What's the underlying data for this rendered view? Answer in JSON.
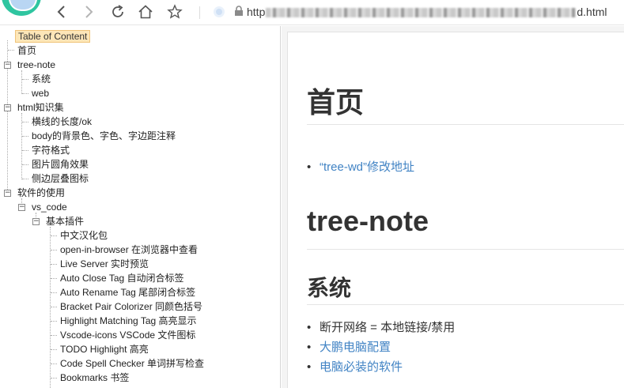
{
  "browser": {
    "url_prefix": "http",
    "url_suffix": "d.html",
    "icons": [
      "back-icon",
      "forward-icon",
      "refresh-icon",
      "home-icon",
      "star-icon",
      "lock-icon"
    ]
  },
  "toc": {
    "title": "Table of Content",
    "items": [
      {
        "label": "首页"
      },
      {
        "label": "tree-note"
      },
      {
        "label": "系统"
      },
      {
        "label": "web"
      },
      {
        "label": "html知识集"
      },
      {
        "label": "横线的长度/ok"
      },
      {
        "label": "body的背景色、字色、字边距注释"
      },
      {
        "label": "字符格式"
      },
      {
        "label": "图片圆角效果"
      },
      {
        "label": "侧边层叠图标"
      },
      {
        "label": "软件的使用"
      },
      {
        "label": "vs_code"
      },
      {
        "label": "基本插件"
      },
      {
        "label": "中文汉化包"
      },
      {
        "label": "open-in-browser 在浏览器中查看"
      },
      {
        "label": "Live Server 实时预览"
      },
      {
        "label": "Auto Close Tag 自动闭合标签"
      },
      {
        "label": "Auto Rename Tag 尾部闭合标签"
      },
      {
        "label": "Bracket Pair Colorizer 同颜色括号"
      },
      {
        "label": "Highlight Matching Tag 高亮显示"
      },
      {
        "label": "Vscode-icons VSCode 文件图标"
      },
      {
        "label": "TODO Highlight 高亮"
      },
      {
        "label": "Code Spell Checker 单词拼写检查"
      },
      {
        "label": "Bookmarks 书签"
      }
    ]
  },
  "content": {
    "h1_home": "首页",
    "home_links": [
      "“tree-wd”修改地址"
    ],
    "h1_tree_note": "tree-note",
    "h2_system": "系统",
    "system_items": [
      {
        "text": "断开网络 = 本地链接/禁用",
        "is_link": false
      },
      {
        "text": "大鹏电脑配置",
        "is_link": true
      },
      {
        "text": "电脑必装的软件",
        "is_link": true
      }
    ]
  },
  "colors": {
    "link": "#4183c4",
    "toc_title_bg": "#fde6b8",
    "heading": "#333333"
  }
}
